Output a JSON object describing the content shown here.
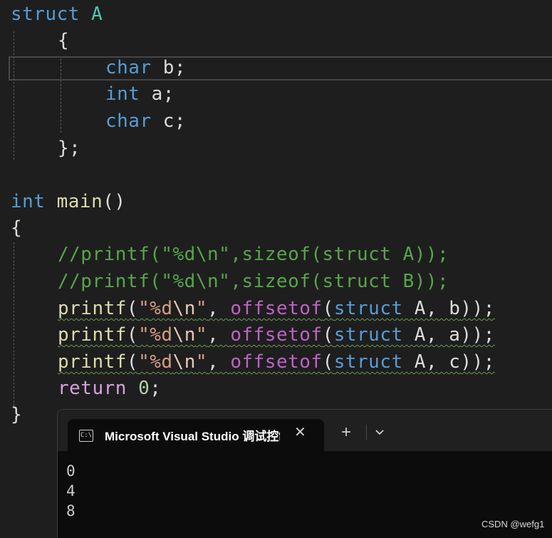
{
  "code": {
    "lines": [
      [
        "struct",
        "A"
      ],
      [
        "{"
      ],
      [
        "char",
        " b;"
      ],
      [
        "int",
        " a;"
      ],
      [
        "char",
        " c;"
      ],
      [
        "};"
      ],
      [
        "int",
        " ",
        "main",
        "()"
      ],
      [
        "{"
      ],
      [
        "//printf(\"%d\\n\",sizeof(struct A));"
      ],
      [
        "//printf(\"%d\\n\",sizeof(struct B));"
      ],
      [
        "printf",
        "(",
        "\"",
        "%d",
        "\\n",
        "\"",
        ", ",
        "offsetof",
        "(",
        "struct",
        " A, b",
        "));"
      ],
      [
        "printf",
        "(",
        "\"",
        "%d",
        "\\n",
        "\"",
        ", ",
        "offsetof",
        "(",
        "struct",
        " A, a",
        "));"
      ],
      [
        "printf",
        "(",
        "\"",
        "%d",
        "\\n",
        "\"",
        ", ",
        "offsetof",
        "(",
        "struct",
        " A, c",
        "));"
      ],
      [
        "return",
        " ",
        "0",
        ";"
      ],
      [
        "}"
      ]
    ]
  },
  "console": {
    "tab_title": "Microsoft Visual Studio 调试控制台",
    "tab_icon_text": "C:\\",
    "close_glyph": "✕",
    "new_tab_glyph": "+",
    "output_lines": [
      "0",
      "4",
      "8"
    ]
  },
  "watermark": "CSDN @wefg1",
  "colors": {
    "keyword": "#569cd6",
    "type": "#4ec9b0",
    "function": "#dcdcaa",
    "string": "#d69d85",
    "macro": "#bd63c5",
    "comment": "#57a64a",
    "control_keyword": "#d8a0df",
    "number": "#b5cea8",
    "background": "#1e1e1e",
    "console_bg": "#0c0c0c"
  }
}
